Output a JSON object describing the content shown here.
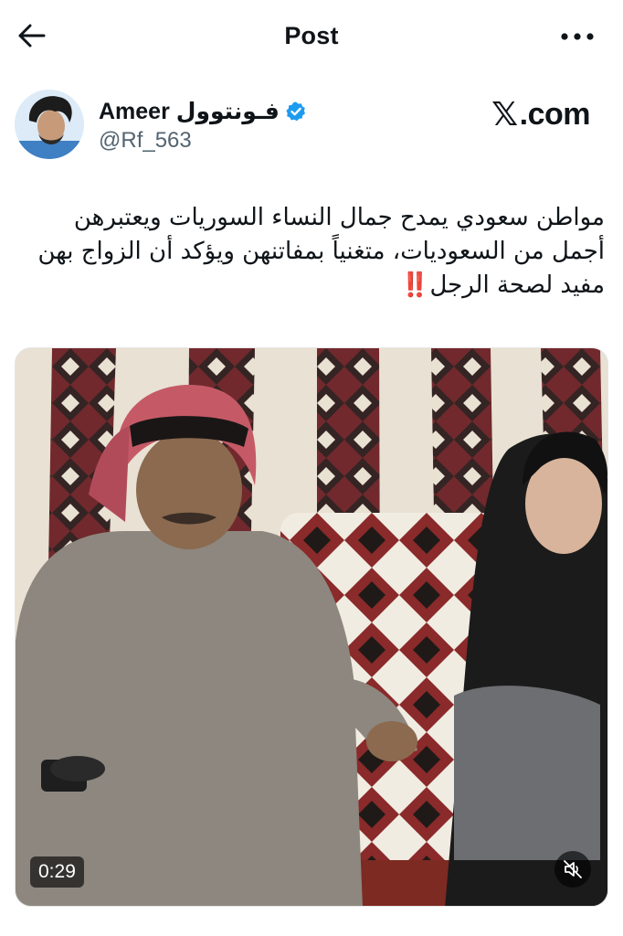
{
  "header": {
    "title": "Post",
    "back_icon": "arrow-left-icon",
    "more_icon": "more-horizontal-icon"
  },
  "author": {
    "name": "Ameer فـونتوول",
    "handle": "@Rf_563",
    "verified": true,
    "verified_color": "#1d9bf0"
  },
  "source": {
    "logo_mark": "𝕏",
    "logo_text": ".com"
  },
  "tweet": {
    "text": "مواطن سعودي يمدح جمال النساء السوريات ويعتبرهن أجمل من السعوديات، متغنياً بمفاتنهن ويؤكد أن الزواج بهن مفيد لصحة الرجل",
    "emoji": "‼️",
    "emoji_color": "#e0242b"
  },
  "media": {
    "type": "video",
    "duration": "0:29",
    "mute_icon": "volume-muted-icon"
  }
}
